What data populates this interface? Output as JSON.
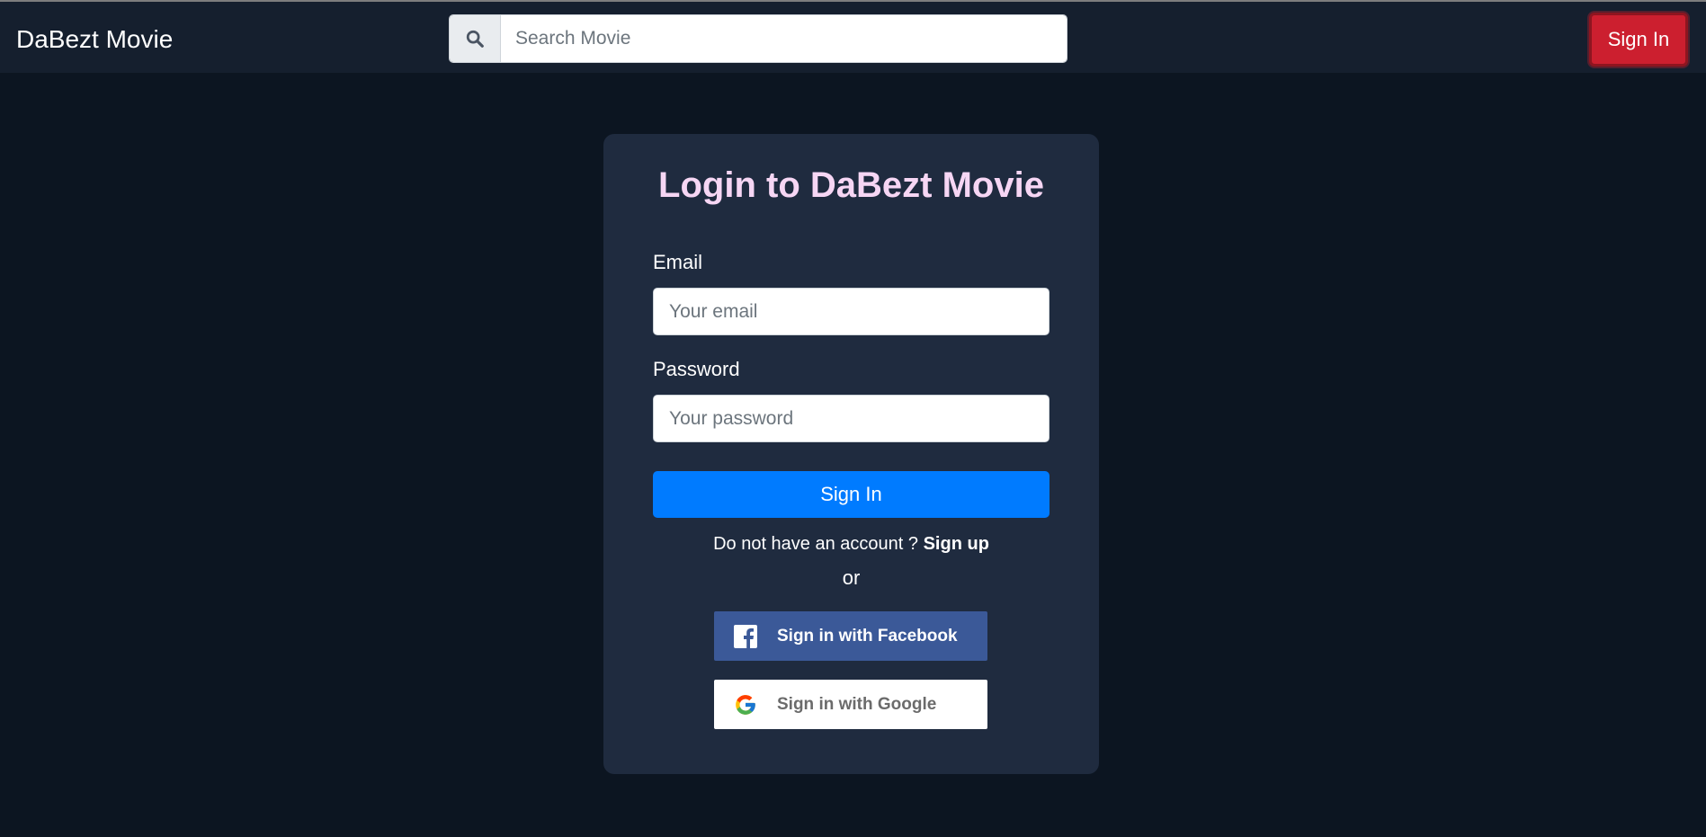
{
  "header": {
    "brand": "DaBezt Movie",
    "search": {
      "placeholder": "Search Movie",
      "value": ""
    },
    "signin_label": "Sign In"
  },
  "login": {
    "title": "Login to DaBezt Movie",
    "email_label": "Email",
    "email_placeholder": "Your email",
    "password_label": "Password",
    "password_placeholder": "Your password",
    "submit_label": "Sign In",
    "no_account_text": "Do not have an account ?",
    "signup_label": "Sign up",
    "or_text": "or",
    "facebook_label": "Sign in with Facebook",
    "google_label": "Sign in with Google"
  },
  "colors": {
    "page_bg": "#0c1521",
    "navbar_bg": "#151f2e",
    "card_bg": "#1f2b3f",
    "title": "#f6d6f4",
    "danger": "#cc1f2f",
    "primary": "#007bff",
    "facebook": "#3b5998"
  },
  "icons": {
    "search": "search-icon",
    "facebook": "facebook-icon",
    "google": "google-icon"
  }
}
